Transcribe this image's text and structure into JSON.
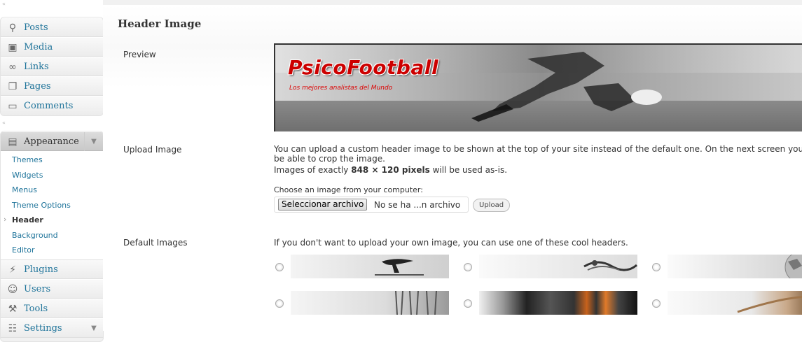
{
  "sidebar": {
    "top_items": [
      {
        "label": "Posts",
        "icon": "pushpin-icon"
      },
      {
        "label": "Media",
        "icon": "media-icon"
      },
      {
        "label": "Links",
        "icon": "link-icon"
      },
      {
        "label": "Pages",
        "icon": "pages-icon"
      },
      {
        "label": "Comments",
        "icon": "comment-icon"
      }
    ],
    "appearance": {
      "label": "Appearance",
      "icon": "appearance-icon",
      "submenu": [
        "Themes",
        "Widgets",
        "Menus",
        "Theme Options",
        "Header",
        "Background",
        "Editor"
      ],
      "current": "Header"
    },
    "bottom_items": [
      {
        "label": "Plugins",
        "icon": "plugin-icon"
      },
      {
        "label": "Users",
        "icon": "users-icon"
      },
      {
        "label": "Tools",
        "icon": "tools-icon"
      },
      {
        "label": "Settings",
        "icon": "settings-icon"
      }
    ]
  },
  "main": {
    "title": "Header Image",
    "preview": {
      "label": "Preview",
      "banner_title": "PsicoFootball",
      "banner_subtitle": "Los mejores analistas del Mundo"
    },
    "upload": {
      "label": "Upload Image",
      "line1": "You can upload a custom header image to be shown at the top of your site instead of the default one. On the next screen you will",
      "line2": "be able to crop the image.",
      "line3_prefix": "Images of exactly ",
      "line3_bold": "848 × 120 pixels",
      "line3_suffix": " will be used as-is.",
      "choose_label": "Choose an image from your computer:",
      "file_button": "Seleccionar archivo",
      "file_status": "No se ha ...n archivo",
      "upload_button": "Upload"
    },
    "defaults": {
      "label": "Default Images",
      "intro": "If you don't want to upload your own image, you can use one of these cool headers."
    }
  },
  "colors": {
    "link": "#21759b",
    "banner_title": "#cc0000"
  }
}
